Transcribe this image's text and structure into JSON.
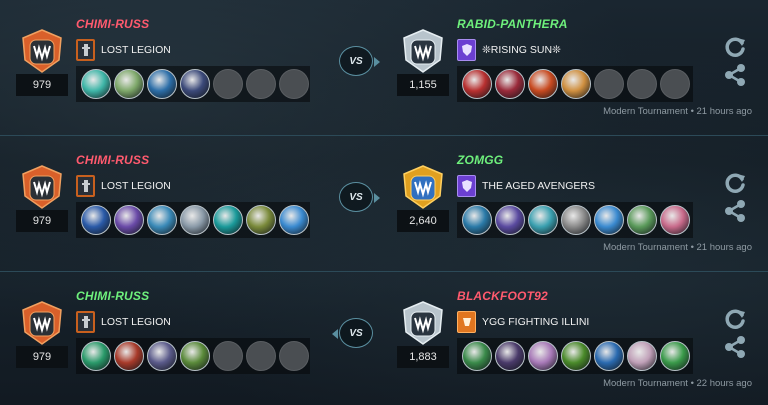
{
  "colors": {
    "loser": "#ff5a6e",
    "winner": "#6ef07c",
    "divider": "#2c4a58"
  },
  "vs_label": "VS",
  "battles": [
    {
      "left": {
        "name": "CHIMI-RUSS",
        "name_color": "red",
        "rating": "979",
        "guild": "LOST LEGION",
        "guild_icon": "legion-shield-icon",
        "cards": [
          "#3fb6a8",
          "#7ea86a",
          "#2c6ea8",
          "#3c4a7a",
          "empty",
          "empty",
          "empty"
        ]
      },
      "right": {
        "name": "RABID-PANTHERA",
        "name_color": "green",
        "rating": "1,155",
        "guild": "❊RISING SUN❊",
        "guild_icon": "purple-shield-icon",
        "cards": [
          "#b83030",
          "#9a2a3a",
          "#c84a20",
          "#d09040",
          "empty",
          "empty",
          "empty"
        ]
      },
      "meta": "Modern Tournament • 21 hours ago"
    },
    {
      "left": {
        "name": "CHIMI-RUSS",
        "name_color": "red",
        "rating": "979",
        "guild": "LOST LEGION",
        "guild_icon": "legion-shield-icon",
        "cards": [
          "#2a5aa8",
          "#6a4aa8",
          "#3a8ab8",
          "#8a9aa8",
          "#1a9a9a",
          "#7a8a3a",
          "#3a8ad0"
        ]
      },
      "right": {
        "name": "ZOMGG",
        "name_color": "green",
        "rating": "2,640",
        "guild": "THE AGED AVENGERS",
        "guild_icon": "purple-shield-icon",
        "cards": [
          "#2a7aa8",
          "#5a4aa0",
          "#3aa0b0",
          "#8a8a8a",
          "#3a8ad0",
          "#5a9a5a",
          "#c86a8a"
        ]
      },
      "meta": "Modern Tournament • 21 hours ago"
    },
    {
      "left": {
        "name": "CHIMI-RUSS",
        "name_color": "green",
        "rating": "979",
        "guild": "LOST LEGION",
        "guild_icon": "legion-shield-icon",
        "cards": [
          "#2a9a6a",
          "#a83a2a",
          "#5a5a8a",
          "#5a8a3a",
          "empty",
          "empty",
          "empty"
        ]
      },
      "right": {
        "name": "BLACKFOOT92",
        "name_color": "red",
        "rating": "1,883",
        "guild": "YGG FIGHTING ILLINI",
        "guild_icon": "orange-guild-icon",
        "cards": [
          "#3a8a4a",
          "#4a3a6a",
          "#a87ab8",
          "#4a8a2a",
          "#2a6ab0",
          "#c0a0b8",
          "#3a9a4a"
        ]
      },
      "meta": "Modern Tournament • 22 hours ago"
    }
  ]
}
